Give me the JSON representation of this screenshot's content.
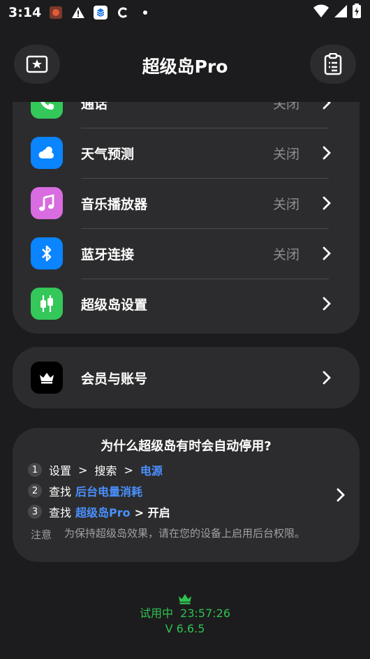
{
  "status_bar": {
    "time": "3:14",
    "icons": [
      "notification-app-icon",
      "warning-icon",
      "stack-app-icon",
      "c-app-icon",
      "dot-icon"
    ],
    "right_icons": [
      "wifi-icon",
      "signal-icon",
      "battery-charging-icon"
    ]
  },
  "header": {
    "title": "超级岛Pro",
    "left_icon": "star-card-icon",
    "right_icon": "clipboard-list-icon"
  },
  "menu": {
    "items": [
      {
        "label": "通话",
        "value": "关闭",
        "icon": "phone-icon",
        "color": "#34c759"
      },
      {
        "label": "天气预测",
        "value": "关闭",
        "icon": "weather-icon",
        "color": "#0a84ff"
      },
      {
        "label": "音乐播放器",
        "value": "关闭",
        "icon": "music-note-icon",
        "color": "#d86ce0"
      },
      {
        "label": "蓝牙连接",
        "value": "关闭",
        "icon": "bluetooth-icon",
        "color": "#0a84ff"
      },
      {
        "label": "超级岛设置",
        "value": "",
        "icon": "sliders-icon",
        "color": "#34c759"
      }
    ]
  },
  "account": {
    "label": "会员与账号",
    "icon": "crown-icon"
  },
  "help": {
    "title": "为什么超级岛有时会自动停用?",
    "steps": [
      {
        "num": "1",
        "a": "设置",
        "b": ">",
        "c": "搜索",
        "d": ">",
        "e": "电源"
      },
      {
        "num": "2",
        "a": "查找",
        "e": "后台电量消耗"
      },
      {
        "num": "3",
        "a": "查找",
        "e": "超级岛Pro",
        "f": "> 开启"
      }
    ],
    "note_label": "注意",
    "note_text": "为保持超级岛效果，请在您的设备上启用后台权限。"
  },
  "footer": {
    "trial": "试用中  23:57:26",
    "version": "V 6.6.5",
    "color": "#30c050"
  }
}
